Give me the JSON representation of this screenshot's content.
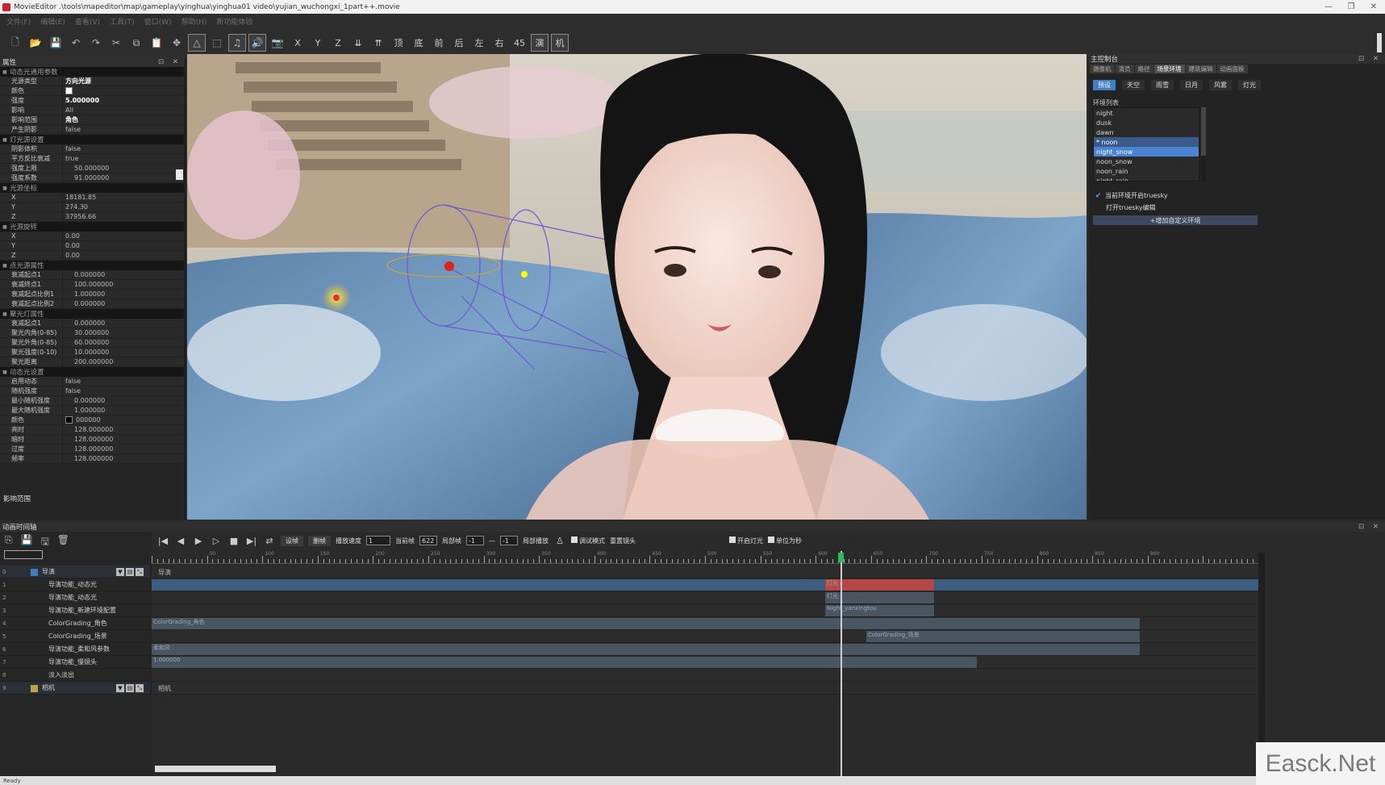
{
  "window": {
    "title": "MovieEditor .\\tools\\mapeditor\\map\\gameplay\\yinghua\\yinghua01 video\\yujian_wuchongxi_1part++.movie",
    "controls": [
      "—",
      "❐",
      "✕"
    ]
  },
  "menubar": {
    "items": [
      "文件(F)",
      "编辑(E)",
      "查看(V)",
      "工具(T)",
      "窗口(W)",
      "帮助(H)",
      "新功能体验"
    ]
  },
  "toolbar": {
    "buttons": [
      {
        "name": "new-file",
        "glyph": "🗋"
      },
      {
        "name": "open-folder",
        "glyph": "📂"
      },
      {
        "name": "save",
        "glyph": "💾"
      },
      {
        "name": "undo",
        "glyph": "↶"
      },
      {
        "name": "redo",
        "glyph": "↷"
      },
      {
        "name": "cut",
        "glyph": "✂"
      },
      {
        "name": "copy",
        "glyph": "⧉"
      },
      {
        "name": "paste",
        "glyph": "📋"
      },
      {
        "name": "move",
        "glyph": "✥"
      },
      {
        "name": "rotate",
        "glyph": "△"
      },
      {
        "name": "scale",
        "glyph": "⬚"
      },
      {
        "name": "music",
        "glyph": "♫"
      },
      {
        "name": "sound",
        "glyph": "🔊"
      },
      {
        "name": "camera",
        "glyph": "📷"
      }
    ],
    "text_buttons": [
      "X",
      "Y",
      "Z",
      "⇊",
      "⇈",
      "顶",
      "底",
      "前",
      "后",
      "左",
      "右",
      "45",
      "演",
      "机"
    ]
  },
  "properties": {
    "title": "属性",
    "panel_controls": "⊡ ✕",
    "sections": [
      {
        "title": "动态光通用参数",
        "rows": [
          {
            "name": "光源类型",
            "value": "方向光源",
            "bold": true
          },
          {
            "name": "颜色",
            "swatch": "white"
          },
          {
            "name": "强度",
            "value": "5.000000",
            "bold": true
          },
          {
            "name": "影响",
            "value": "All"
          },
          {
            "name": "影响范围",
            "value": "角色",
            "bold": true
          },
          {
            "name": "产生阴影",
            "value": "false"
          }
        ]
      },
      {
        "title": "灯光源设置",
        "rows": [
          {
            "name": "阴影体积",
            "value": "false"
          },
          {
            "name": "平方反比衰减",
            "value": "true"
          },
          {
            "name": "强度上限",
            "value": "50.000000",
            "num": true
          },
          {
            "name": "强度系数",
            "value": "91.000000",
            "num": true
          }
        ]
      },
      {
        "title": "光源坐标",
        "rows": [
          {
            "name": "X",
            "value": "18181.85"
          },
          {
            "name": "Y",
            "value": "274.30"
          },
          {
            "name": "Z",
            "value": "37956.66"
          }
        ]
      },
      {
        "title": "光源旋转",
        "rows": [
          {
            "name": "X",
            "value": "0.00"
          },
          {
            "name": "Y",
            "value": "0.00"
          },
          {
            "name": "Z",
            "value": "0.00"
          }
        ]
      },
      {
        "title": "点光源属性",
        "rows": [
          {
            "name": "衰减起点1",
            "value": "0.000000",
            "num": true
          },
          {
            "name": "衰减终点1",
            "value": "100.000000",
            "num": true
          },
          {
            "name": "衰减起点比例1",
            "value": "1.000000",
            "num": true
          },
          {
            "name": "衰减起点比例2",
            "value": "0.000000",
            "num": true
          }
        ]
      },
      {
        "title": "聚光灯属性",
        "rows": [
          {
            "name": "衰减起点1",
            "value": "0.000000",
            "num": true
          },
          {
            "name": "聚光内角(0-85)",
            "value": "30.000000",
            "num": true
          },
          {
            "name": "聚光外角(0-85)",
            "value": "60.000000",
            "num": true
          },
          {
            "name": "聚光强度(0-10)",
            "value": "10.000000",
            "num": true
          },
          {
            "name": "聚光距离",
            "value": "200.000000",
            "num": true
          }
        ]
      },
      {
        "title": "动态光设置",
        "rows": [
          {
            "name": "启用动态",
            "value": "false"
          },
          {
            "name": "随机强度",
            "value": "false"
          },
          {
            "name": "最小随机强度",
            "value": "0.000000",
            "num": true
          },
          {
            "name": "最大随机强度",
            "value": "1.000000",
            "num": true
          },
          {
            "name": "颜色",
            "value": "000000",
            "swatch": "black"
          },
          {
            "name": "亮时",
            "value": "128.000000",
            "num": true
          },
          {
            "name": "暗时",
            "value": "128.000000",
            "num": true
          },
          {
            "name": "过度",
            "value": "128.000000",
            "num": true
          },
          {
            "name": "频率",
            "value": "128.000000",
            "num": true
          }
        ]
      }
    ],
    "description": "影响范围"
  },
  "control_panel": {
    "title": "主控制台",
    "panel_controls": "⊡ ✕",
    "tabs": [
      {
        "label": "摄像机",
        "active": false
      },
      {
        "label": "演员",
        "active": false
      },
      {
        "label": "路径",
        "active": false
      },
      {
        "label": "场景环境",
        "active": true
      },
      {
        "label": "建筑编辑",
        "active": false
      },
      {
        "label": "动画面板",
        "active": false
      }
    ],
    "buttons": [
      {
        "label": "预设",
        "active": true
      },
      {
        "label": "天空",
        "active": false
      },
      {
        "label": "雨雪",
        "active": false
      },
      {
        "label": "日月",
        "active": false
      },
      {
        "label": "风雾",
        "active": false
      },
      {
        "label": "灯光",
        "active": false
      }
    ],
    "env_list_label": "环境列表",
    "env_list": [
      {
        "label": "night",
        "state": ""
      },
      {
        "label": "dusk",
        "state": ""
      },
      {
        "label": "dawn",
        "state": ""
      },
      {
        "label": "* noon",
        "state": "cur"
      },
      {
        "label": "night_snow",
        "state": "sel"
      },
      {
        "label": "noon_snow",
        "state": ""
      },
      {
        "label": "noon_rain",
        "state": ""
      },
      {
        "label": "night_rain",
        "state": ""
      }
    ],
    "checkbox_truesky": "当前环境开启truesky",
    "open_truesky_editor": "打开truesky编辑",
    "add_custom_env": "+增加自定义环境"
  },
  "timeline": {
    "title": "动画时间轴",
    "panel_controls": "⊡ ✕",
    "left_tools": [
      "⎘",
      "💾",
      "🖫",
      "🗑"
    ],
    "tracks": [
      {
        "idx": "0",
        "label": "导演",
        "group": true,
        "color": "blue"
      },
      {
        "idx": "1",
        "label": "导演功能_动态光"
      },
      {
        "idx": "2",
        "label": "导演功能_动态光"
      },
      {
        "idx": "3",
        "label": "导演功能_新建环境配置"
      },
      {
        "idx": "4",
        "label": "ColorGrading_角色"
      },
      {
        "idx": "5",
        "label": "ColorGrading_场景"
      },
      {
        "idx": "6",
        "label": "导演功能_柔和风参数"
      },
      {
        "idx": "7",
        "label": "导演功能_慢镜头"
      },
      {
        "idx": "8",
        "label": "淡入淡出"
      },
      {
        "idx": "9",
        "label": "相机",
        "group": true,
        "color": "yellow"
      }
    ],
    "controls": {
      "play_buttons": [
        "|◀",
        "◀",
        "▶",
        "▷",
        "■",
        "▶|",
        "⇄"
      ],
      "set_label": "设帧",
      "delete_label": "删帧",
      "speed_label": "播放速度",
      "speed_value": "1",
      "current_frame_label": "当前帧",
      "current_frame_value": "622",
      "range_label": "局部帧",
      "range_start": "-1",
      "range_sep": "—",
      "range_end": "-1",
      "range_play_label": "局部播放",
      "debug_mode_label": "调试模式",
      "reset_camera_label": "重置镜头",
      "enable_light_label": "开启灯光",
      "unit_label": "单位为秒"
    },
    "ruler_labels": [
      "50",
      "100",
      "150",
      "200",
      "250",
      "300",
      "350",
      "400",
      "450",
      "500",
      "550",
      "600",
      "650",
      "700",
      "750",
      "800",
      "850",
      "900"
    ],
    "director_track_label": "导演",
    "camera_track_label": "相机",
    "clips": {
      "light_a": "灯光",
      "light_b": "灯光",
      "env_cfg": "Night_yanxingtou",
      "cg_role": "ColorGrading_角色",
      "cg_scene": "ColorGrading_场景",
      "wind": "柔和风",
      "slow": "1.000000"
    },
    "current_frame_ratio": 0.6228
  },
  "status": {
    "text": "Ready"
  },
  "watermark": "Easck.Net",
  "colors": {
    "accent": "#4b82d1",
    "playhead": "#21c05a",
    "light_clip": "#b64747"
  }
}
